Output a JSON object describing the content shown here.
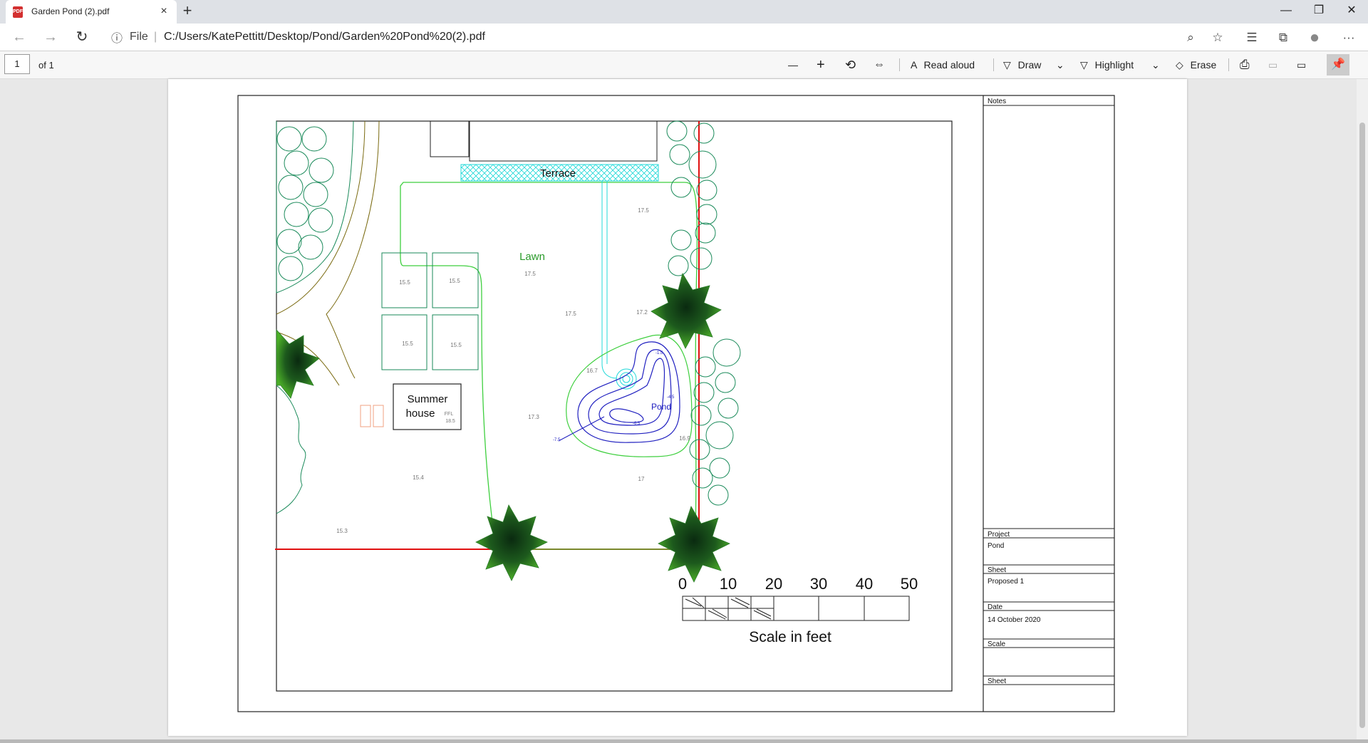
{
  "browser": {
    "tab_title": "Garden Pond (2).pdf",
    "tab_close": "×",
    "new_tab": "+",
    "window_controls": {
      "minimize": "—",
      "restore": "❐",
      "close": "✕"
    },
    "back_icon": "←",
    "forward_icon": "→",
    "refresh_icon": "↻",
    "info_icon": "ⓘ",
    "file_label": "File",
    "url": "C:/Users/KatePettitt/Desktop/Pond/Garden%20Pond%20(2).pdf",
    "zoom_icon": "⌕",
    "favorite_icon": "☆",
    "favorites_icon": "☰",
    "collections_icon": "⧉",
    "profile_icon": "●",
    "more_icon": "···"
  },
  "pdf_toolbar": {
    "page_number": "1",
    "page_of": "of 1",
    "zoom_out": "—",
    "zoom_in": "+",
    "rotate_icon": "⟲",
    "fit_icon": "⇔",
    "read_aloud": "Read aloud",
    "read_aloud_icon": "A",
    "draw": "Draw",
    "draw_icon": "▽",
    "highlight": "Highlight",
    "highlight_icon": "▽",
    "dropdown_icon": "⌄",
    "erase": "Erase",
    "erase_icon": "◇",
    "print_icon": "⎙",
    "save_icon": "▭",
    "saveas_icon": "▭",
    "pin_icon": "📌"
  },
  "drawing": {
    "labels": {
      "terrace": "Terrace",
      "lawn": "Lawn",
      "summer_house_line1": "Summer",
      "summer_house_line2": "house",
      "ffl": "FFL",
      "ffl_value": "18.5",
      "pond": "Pond"
    },
    "levels": [
      "17.5",
      "15.5",
      "15.5",
      "15.5",
      "15.5",
      "17.5",
      "17.5",
      "17.2",
      "16.7",
      "17.3",
      "16.9",
      "17",
      "15.4",
      "15.3"
    ],
    "pond_depths": [
      "-1.5",
      "-4.5",
      "-6.5",
      "-7.5"
    ],
    "scale_bar": {
      "ticks": [
        "0",
        "10",
        "20",
        "30",
        "40",
        "50"
      ],
      "caption": "Scale in feet"
    }
  },
  "title_block": {
    "notes_label": "Notes",
    "project_label": "Project",
    "project_value": "Pond",
    "sheet_label": "Sheet",
    "sheet_value": "Proposed 1",
    "date_label": "Date",
    "date_value": "14 October 2020",
    "scale_label": "Scale",
    "scale_value": "",
    "sheet2_label": "Sheet",
    "sheet2_value": ""
  },
  "colors": {
    "boundary_red": "#e01010",
    "lawn_green": "#3ecf3e",
    "hedge_teal": "#1a8a5a",
    "pond_blue": "#2020c0",
    "terrace_cyan": "#20d8d8",
    "summerhouse_orange": "#f0a080",
    "path_olive": "#7a6a10"
  }
}
